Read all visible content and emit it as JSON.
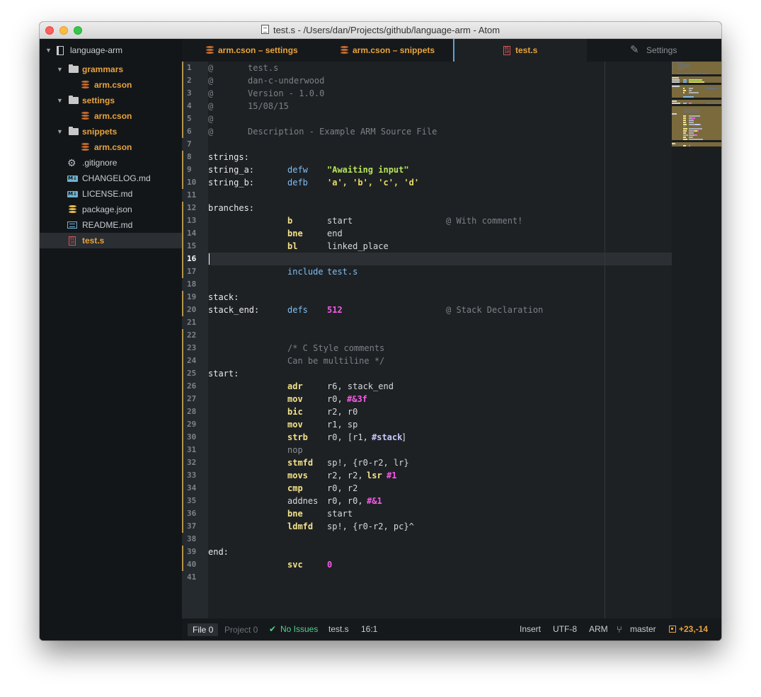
{
  "window": {
    "title": "test.s - /Users/dan/Projects/github/language-arm - Atom"
  },
  "sidebar": {
    "root": "language-arm",
    "items": [
      {
        "label": "grammars",
        "kind": "folder"
      },
      {
        "label": "arm.cson",
        "kind": "cson"
      },
      {
        "label": "settings",
        "kind": "folder"
      },
      {
        "label": "arm.cson",
        "kind": "cson"
      },
      {
        "label": "snippets",
        "kind": "folder"
      },
      {
        "label": "arm.cson",
        "kind": "cson"
      },
      {
        "label": ".gitignore",
        "kind": "gear"
      },
      {
        "label": "CHANGELOG.md",
        "kind": "md"
      },
      {
        "label": "LICENSE.md",
        "kind": "md"
      },
      {
        "label": "package.json",
        "kind": "json"
      },
      {
        "label": "README.md",
        "kind": "readme"
      },
      {
        "label": "test.s",
        "kind": "binary"
      }
    ],
    "md_icon_text": "M↓"
  },
  "tabs": [
    {
      "label": "arm.cson – settings"
    },
    {
      "label": "arm.cson – snippets"
    },
    {
      "label": "test.s"
    },
    {
      "label": "Settings"
    }
  ],
  "editor": {
    "line_numbers": [
      "1",
      "2",
      "3",
      "4",
      "5",
      "6",
      "7",
      "8",
      "9",
      "10",
      "11",
      "12",
      "13",
      "14",
      "15",
      "16",
      "17",
      "18",
      "19",
      "20",
      "21",
      "22",
      "23",
      "24",
      "25",
      "26",
      "27",
      "28",
      "29",
      "30",
      "31",
      "32",
      "33",
      "34",
      "35",
      "36",
      "37",
      "38",
      "39",
      "40",
      "41"
    ],
    "lines": [
      {
        "t": [
          [
            "@",
            0,
            "comment"
          ],
          [
            "test.s",
            56,
            "comment"
          ]
        ]
      },
      {
        "t": [
          [
            "@",
            0,
            "comment"
          ],
          [
            "dan-c-underwood",
            56,
            "comment"
          ]
        ]
      },
      {
        "t": [
          [
            "@",
            0,
            "comment"
          ],
          [
            "Version - 1.0.0",
            56,
            "comment"
          ]
        ]
      },
      {
        "t": [
          [
            "@",
            0,
            "comment"
          ],
          [
            "15/08/15",
            56,
            "comment"
          ]
        ]
      },
      {
        "t": [
          [
            "@",
            0,
            "comment"
          ]
        ]
      },
      {
        "t": [
          [
            "@",
            0,
            "comment"
          ],
          [
            "Description - Example ARM Source File",
            56,
            "comment"
          ]
        ]
      },
      {
        "t": []
      },
      {
        "t": [
          [
            "strings:",
            0,
            "label"
          ]
        ]
      },
      {
        "t": [
          [
            "string_a:",
            0,
            "label"
          ],
          [
            "defw",
            112,
            "dir"
          ],
          [
            "\"Awaiting input\"",
            168,
            "str"
          ]
        ]
      },
      {
        "t": [
          [
            "string_b:",
            0,
            "label"
          ],
          [
            "defb",
            112,
            "dir"
          ],
          [
            "'a', 'b', 'c', 'd'",
            168,
            "chr"
          ]
        ]
      },
      {
        "t": []
      },
      {
        "t": [
          [
            "branches:",
            0,
            "label"
          ]
        ]
      },
      {
        "t": [
          [
            "b",
            112,
            "ins"
          ],
          [
            "start",
            168,
            "plain"
          ],
          [
            "@ With comment!",
            336,
            "comment"
          ]
        ]
      },
      {
        "t": [
          [
            "bne",
            112,
            "ins"
          ],
          [
            "end",
            168,
            "plain"
          ]
        ]
      },
      {
        "t": [
          [
            "bl",
            112,
            "ins"
          ],
          [
            "linked_place",
            168,
            "plain"
          ]
        ]
      },
      {
        "t": []
      },
      {
        "t": [
          [
            "include",
            112,
            "dir"
          ],
          [
            "test.s",
            168,
            "dir"
          ]
        ]
      },
      {
        "t": []
      },
      {
        "t": [
          [
            "stack:",
            0,
            "label"
          ]
        ]
      },
      {
        "t": [
          [
            "stack_end:",
            0,
            "label"
          ],
          [
            "defs",
            112,
            "dir"
          ],
          [
            "512",
            168,
            "num"
          ],
          [
            "@ Stack Declaration",
            336,
            "comment"
          ]
        ]
      },
      {
        "t": []
      },
      {
        "t": []
      },
      {
        "t": [
          [
            "/* C Style comments",
            112,
            "comment"
          ]
        ]
      },
      {
        "t": [
          [
            "Can be multiline */",
            112,
            "comment"
          ]
        ]
      },
      {
        "t": [
          [
            "start:",
            0,
            "label"
          ]
        ]
      },
      {
        "t": [
          [
            "adr",
            112,
            "ins"
          ],
          [
            "r6, stack_end",
            168,
            "plain"
          ]
        ]
      },
      {
        "t": [
          [
            "mov",
            112,
            "ins"
          ],
          [
            "r0, ",
            168,
            "plain"
          ],
          [
            "#&3f",
            196,
            "num"
          ]
        ]
      },
      {
        "t": [
          [
            "bic",
            112,
            "ins"
          ],
          [
            "r2, r0",
            168,
            "plain"
          ]
        ]
      },
      {
        "t": [
          [
            "mov",
            112,
            "ins"
          ],
          [
            "r1, sp",
            168,
            "plain"
          ]
        ]
      },
      {
        "t": [
          [
            "strb",
            112,
            "ins"
          ],
          [
            "r0, [r1, ",
            168,
            "plain"
          ],
          [
            "#stack",
            231,
            "sym"
          ],
          [
            "]",
            273,
            "plain"
          ]
        ]
      },
      {
        "t": [
          [
            "nop",
            112,
            "nop"
          ]
        ]
      },
      {
        "t": [
          [
            "stmfd",
            112,
            "ins"
          ],
          [
            "sp!, {r0-r2, lr}",
            168,
            "plain"
          ]
        ]
      },
      {
        "t": [
          [
            "movs",
            112,
            "ins"
          ],
          [
            "r2, r2, ",
            168,
            "plain"
          ],
          [
            "lsr",
            224,
            "ins"
          ],
          [
            "#1",
            252,
            "num"
          ]
        ]
      },
      {
        "t": [
          [
            "cmp",
            112,
            "ins"
          ],
          [
            "r0, r2",
            168,
            "plain"
          ]
        ]
      },
      {
        "t": [
          [
            "addnes",
            112,
            "plain"
          ],
          [
            "r0, r0, ",
            168,
            "plain"
          ],
          [
            "#&1",
            224,
            "num"
          ]
        ]
      },
      {
        "t": [
          [
            "bne",
            112,
            "ins"
          ],
          [
            "start",
            168,
            "plain"
          ]
        ]
      },
      {
        "t": [
          [
            "ldmfd",
            112,
            "ins"
          ],
          [
            "sp!, {r0-r2, pc}^",
            168,
            "plain"
          ]
        ]
      },
      {
        "t": []
      },
      {
        "t": [
          [
            "end:",
            0,
            "label"
          ]
        ]
      },
      {
        "t": [
          [
            "svc",
            112,
            "ins"
          ],
          [
            "0",
            168,
            "num"
          ]
        ]
      },
      {
        "t": []
      }
    ],
    "modified_lines": [
      1,
      2,
      3,
      4,
      5,
      6,
      8,
      9,
      10,
      12,
      13,
      14,
      15,
      16,
      17,
      19,
      20,
      22,
      23,
      24,
      25,
      26,
      27,
      28,
      29,
      30,
      31,
      32,
      33,
      34,
      35,
      36,
      37,
      39,
      40
    ],
    "current_line": 16
  },
  "status": {
    "file_tab": "File 0",
    "project_tab": "Project 0",
    "linter": "No Issues",
    "filename": "test.s",
    "cursor": "16:1",
    "mode": "Insert",
    "encoding": "UTF-8",
    "grammar": "ARM",
    "branch": "master",
    "diff": "+23,-14"
  },
  "colors": {
    "accent": "#e8a33c",
    "tab_active_indicator": "#5ea4d4",
    "ok": "#4fd18b"
  }
}
